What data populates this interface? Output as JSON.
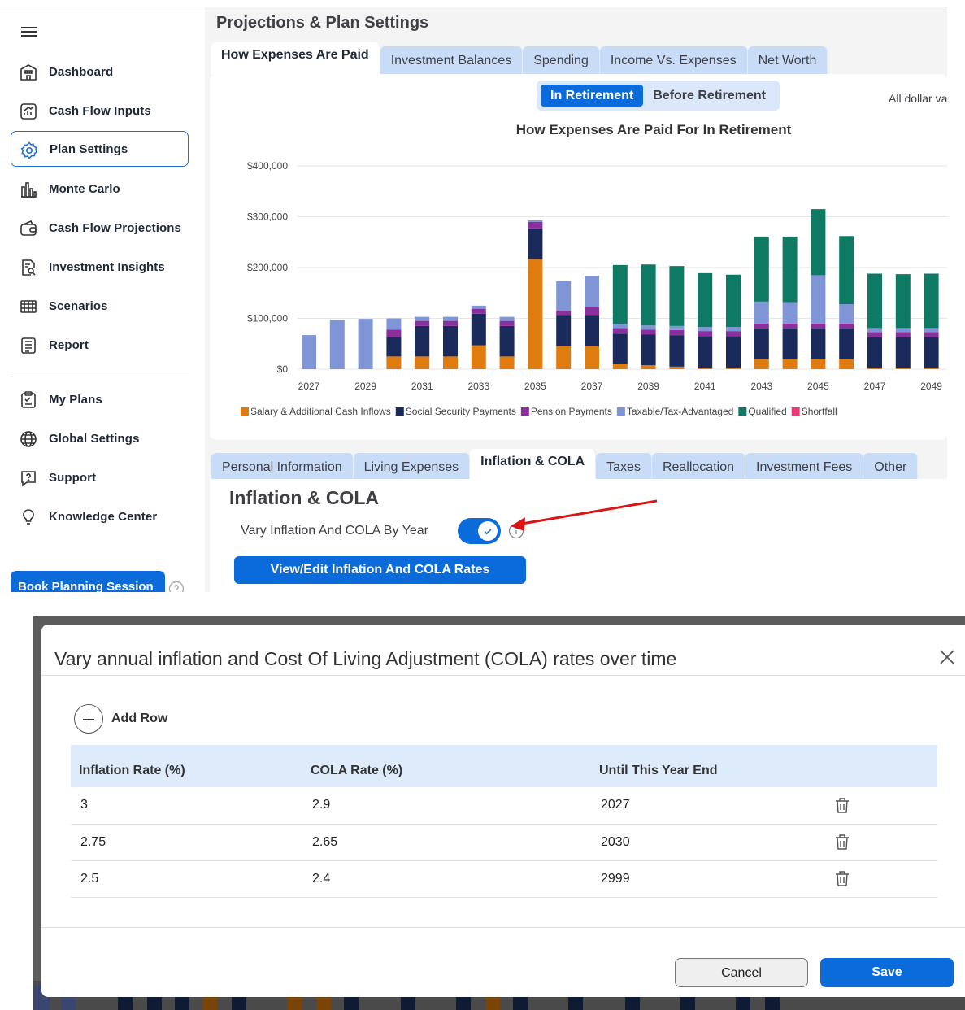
{
  "sidebar": {
    "items": [
      {
        "label": "Dashboard",
        "icon": "dashboard-icon"
      },
      {
        "label": "Cash Flow Inputs",
        "icon": "cash-flow-inputs-icon"
      },
      {
        "label": "Plan Settings",
        "icon": "gear-icon",
        "active": true
      },
      {
        "label": "Monte Carlo",
        "icon": "bar-chart-icon"
      },
      {
        "label": "Cash Flow Projections",
        "icon": "wallet-icon"
      },
      {
        "label": "Investment Insights",
        "icon": "document-search-icon"
      },
      {
        "label": "Scenarios",
        "icon": "scenarios-icon"
      },
      {
        "label": "Report",
        "icon": "report-icon"
      }
    ],
    "secondary": [
      {
        "label": "My Plans",
        "icon": "clipboard-icon"
      },
      {
        "label": "Global Settings",
        "icon": "globe-icon"
      },
      {
        "label": "Support",
        "icon": "help-bubble-icon"
      },
      {
        "label": "Knowledge Center",
        "icon": "lightbulb-icon"
      }
    ],
    "book_button": "Book Planning Session"
  },
  "page": {
    "title": "Projections & Plan Settings",
    "chart_tabs": [
      "How Expenses Are Paid",
      "Investment Balances",
      "Spending",
      "Income Vs. Expenses",
      "Net Worth"
    ],
    "active_chart_tab": 0,
    "toggle": {
      "options": [
        "In Retirement",
        "Before Retirement"
      ],
      "selected": "In Retirement"
    },
    "dollar_note": "All dollar va",
    "settings_tabs": [
      "Personal Information",
      "Living Expenses",
      "Inflation & COLA",
      "Taxes",
      "Reallocation",
      "Investment Fees",
      "Other"
    ],
    "active_settings_tab": 2,
    "section_title": "Inflation & COLA",
    "vary_label": "Vary Inflation And COLA By Year",
    "vary_enabled": true,
    "edit_button": "View/Edit Inflation And COLA Rates"
  },
  "chart_data": {
    "type": "bar",
    "stacked": true,
    "title": "How Expenses Are Paid For In Retirement",
    "x": [
      2027,
      2028,
      2029,
      2030,
      2031,
      2032,
      2033,
      2034,
      2035,
      2036,
      2037,
      2038,
      2039,
      2040,
      2041,
      2042,
      2043,
      2044,
      2045,
      2046,
      2047,
      2048,
      2049
    ],
    "x_tick_labels": [
      "2027",
      "2029",
      "2031",
      "2033",
      "2035",
      "2037",
      "2039",
      "2041",
      "2043",
      "2045",
      "2047",
      "2049"
    ],
    "y_tick_labels": [
      "$0",
      "$100,000",
      "$200,000",
      "$300,000",
      "$400,000"
    ],
    "ylim": [
      0,
      400000
    ],
    "legend_position": "bottom",
    "series": [
      {
        "name": "Salary & Additional Cash Inflows",
        "color": "#e07b0f",
        "values": [
          0,
          0,
          0,
          25000,
          25000,
          25000,
          47000,
          25000,
          217000,
          45000,
          45000,
          10000,
          8000,
          5000,
          3000,
          3000,
          20000,
          20000,
          20000,
          20000,
          3000,
          3000,
          3000
        ]
      },
      {
        "name": "Social Security Payments",
        "color": "#1a2a5a",
        "values": [
          0,
          0,
          0,
          38000,
          60000,
          60000,
          62000,
          60000,
          60000,
          62000,
          62000,
          60000,
          60000,
          62000,
          62000,
          62000,
          60000,
          60000,
          60000,
          60000,
          60000,
          60000,
          60000
        ]
      },
      {
        "name": "Pension Payments",
        "color": "#8b2f9f",
        "values": [
          0,
          0,
          0,
          15000,
          10000,
          10000,
          10000,
          10000,
          13000,
          8000,
          15000,
          11000,
          10000,
          10000,
          10000,
          10000,
          10000,
          10000,
          10000,
          10000,
          10000,
          10000,
          10000
        ]
      },
      {
        "name": "Taxable/Tax-Advantaged",
        "color": "#7f95d5",
        "values": [
          67000,
          97000,
          99000,
          22000,
          8000,
          8000,
          6000,
          8000,
          3000,
          58000,
          62000,
          8000,
          8000,
          8000,
          8000,
          8000,
          43000,
          42000,
          95000,
          38000,
          8000,
          8000,
          8000
        ]
      },
      {
        "name": "Qualified",
        "color": "#0f7a64",
        "values": [
          0,
          0,
          0,
          0,
          0,
          0,
          0,
          0,
          0,
          0,
          0,
          116000,
          120000,
          118000,
          106000,
          103000,
          128000,
          129000,
          130000,
          134000,
          107000,
          106000,
          107000
        ]
      },
      {
        "name": "Shortfall",
        "color": "#e73b73",
        "values": [
          0,
          0,
          0,
          0,
          0,
          0,
          0,
          0,
          0,
          0,
          0,
          0,
          0,
          0,
          0,
          0,
          0,
          0,
          0,
          0,
          0,
          0,
          0
        ]
      }
    ]
  },
  "modal": {
    "title": "Vary annual inflation and Cost Of Living Adjustment (COLA) rates over time",
    "add_row": "Add Row",
    "columns": [
      "Inflation Rate (%)",
      "COLA Rate (%)",
      "Until This Year End"
    ],
    "rows": [
      {
        "inflation": "3",
        "cola": "2.9",
        "until": "2027"
      },
      {
        "inflation": "2.75",
        "cola": "2.65",
        "until": "2030"
      },
      {
        "inflation": "2.5",
        "cola": "2.4",
        "until": "2999"
      }
    ],
    "cancel": "Cancel",
    "save": "Save"
  }
}
